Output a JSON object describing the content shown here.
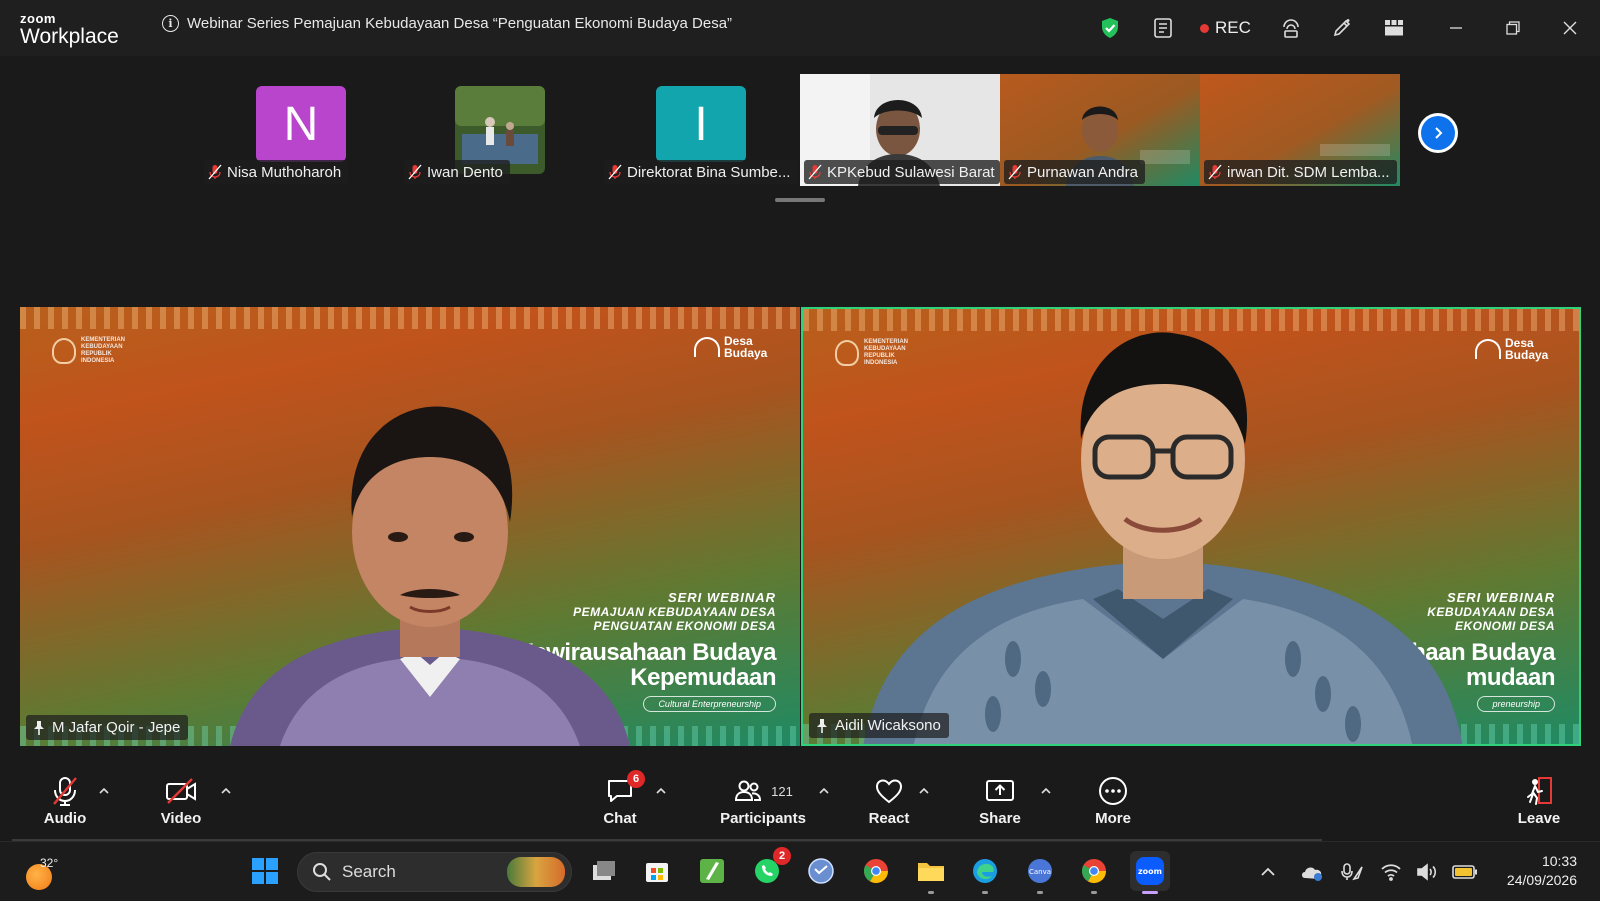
{
  "app": {
    "brand_small": "zoom",
    "brand_big": "Workplace"
  },
  "meeting": {
    "title": "Webinar Series Pemajuan Kebudayaan Desa “Penguatan Ekonomi Budaya Desa”",
    "rec_label": "REC"
  },
  "colors": {
    "accent_blue": "#0e72ed",
    "active_speaker": "#2fd27a",
    "badge_red": "#e02828",
    "rec_red": "#e53935"
  },
  "thumbnails": [
    {
      "name": "Nisa Muthoharoh",
      "initial": "N",
      "avatar_color": "#b845cc",
      "type": "avatar"
    },
    {
      "name": "Iwan Dento",
      "type": "video"
    },
    {
      "name": "Direktorat Bina Sumbe...",
      "initial": "I",
      "avatar_color": "#12a5ad",
      "type": "avatar"
    },
    {
      "name": "KPKebud Sulawesi Barat",
      "type": "video"
    },
    {
      "name": "Purnawan Andra",
      "type": "video"
    },
    {
      "name": "irwan Dit. SDM Lemba...",
      "type": "video"
    }
  ],
  "tiles": [
    {
      "name": "M Jafar Qoir - Jepe",
      "banner": {
        "kementerian": [
          "KEMENTERIAN",
          "KEBUDAYAAN",
          "REPUBLIK",
          "INDONESIA"
        ],
        "desa": [
          "Desa",
          "Budaya"
        ],
        "line1": "SERI WEBINAR",
        "line2": "PEMAJUAN KEBUDAYAAN DESA",
        "line2b": "PENGUATAN EKONOMI DESA",
        "line3": "Kewirausahaan Budaya",
        "line4": "Kepemudaan",
        "pill": "Cultural Enterpreneurship"
      }
    },
    {
      "name": "Aidil Wicaksono",
      "active": true,
      "banner": {
        "kementerian": [
          "KEMENTERIAN",
          "KEBUDAYAAN",
          "REPUBLIK",
          "INDONESIA"
        ],
        "desa": [
          "Desa",
          "Budaya"
        ],
        "line1": "SERI WEBINAR",
        "line2": "KEBUDAYAAN DESA",
        "line2b": "EKONOMI DESA",
        "line3": "haan Budaya",
        "line4": "mudaan",
        "pill": "preneurship"
      }
    }
  ],
  "toolbar": {
    "audio": "Audio",
    "video": "Video",
    "chat": "Chat",
    "chat_badge": "6",
    "participants": "Participants",
    "participants_count": "121",
    "react": "React",
    "share": "Share",
    "more": "More",
    "leave": "Leave"
  },
  "taskbar": {
    "weather_temp": "32°",
    "search_placeholder": "Search",
    "whatsapp_badge": "2",
    "time": "10:33",
    "date": "24/09/2026"
  }
}
